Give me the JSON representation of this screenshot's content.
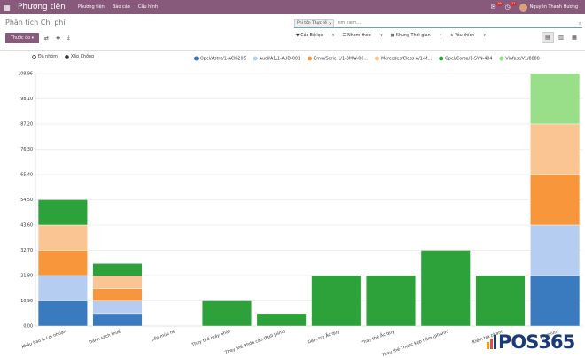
{
  "app": {
    "brand": "Phương tiện",
    "menu": [
      "Phương tiện",
      "Báo cáo",
      "Cấu hình"
    ]
  },
  "topright": {
    "chat_badge": "19",
    "activity_badge": "11",
    "user": "Nguyễn Thanh Hương"
  },
  "page": {
    "title": "Phân tích Chi phí"
  },
  "search": {
    "facet": "Phí tổn Thực tế",
    "placeholder": "Tìm kiếm..."
  },
  "toolbar": {
    "measures_label": "Thước đo",
    "filters_label": "Các Bộ lọc",
    "groupby_label": "Nhóm theo",
    "time_label": "Khung Thời gian",
    "favorites_label": "Yêu thích"
  },
  "chart_mode": {
    "grouped": "Đã nhóm",
    "stacked": "Xếp Chồng"
  },
  "colors": [
    "#3a7bbf",
    "#b5cdf0",
    "#f7963a",
    "#fbc593",
    "#2ea23a",
    "#99df8a"
  ],
  "chart_data": {
    "type": "bar",
    "stacked": true,
    "categories": [
      "Khấu hao & Lợi nhuận",
      "Danh sách thuế",
      "Lốp mùa hè",
      "Thay thế máy phát",
      "Thay thế Khớp cầu (Ball Joint)",
      "Kiểm tra Ắc quy",
      "Thay thế Ắc quy",
      "Thay thế Thước kẹp hãm (phanh)",
      "Kiểm tra phanh",
      "Premium"
    ],
    "series": [
      {
        "name": "Opel/Astra/1-ACK-205",
        "values": [
          10.9,
          5.4,
          0,
          0,
          0,
          0,
          0,
          0,
          0,
          21.8
        ]
      },
      {
        "name": "Audi/A1/1-AUD-001",
        "values": [
          10.9,
          5.4,
          0,
          0,
          0,
          0,
          0,
          0,
          0,
          21.8
        ]
      },
      {
        "name": "Bmw/Serie 1/1-BMW-00...",
        "values": [
          10.9,
          5.4,
          0,
          0,
          0,
          0,
          0,
          0,
          0,
          21.8
        ]
      },
      {
        "name": "Mercedes/Class A/1-M...",
        "values": [
          10.9,
          5.4,
          0,
          0,
          0,
          0,
          0,
          0,
          0,
          21.8
        ]
      },
      {
        "name": "Opel/Corsa/1-SYN-404",
        "values": [
          10.9,
          5.4,
          0,
          10.9,
          5.4,
          21.8,
          21.8,
          32.7,
          21.8,
          0
        ]
      },
      {
        "name": "Vinfast/V1/8888",
        "values": [
          0,
          0,
          0,
          0,
          0,
          0,
          0,
          0,
          0,
          21.8
        ]
      }
    ],
    "yticks": [
      "0,00",
      "10,90",
      "21,80",
      "32,70",
      "43,60",
      "54,50",
      "65,40",
      "76,30",
      "87,20",
      "98,10",
      "108,96"
    ],
    "ylim": [
      0,
      108.96
    ],
    "legend": "top-right",
    "grid": true
  },
  "watermark": "POS365"
}
